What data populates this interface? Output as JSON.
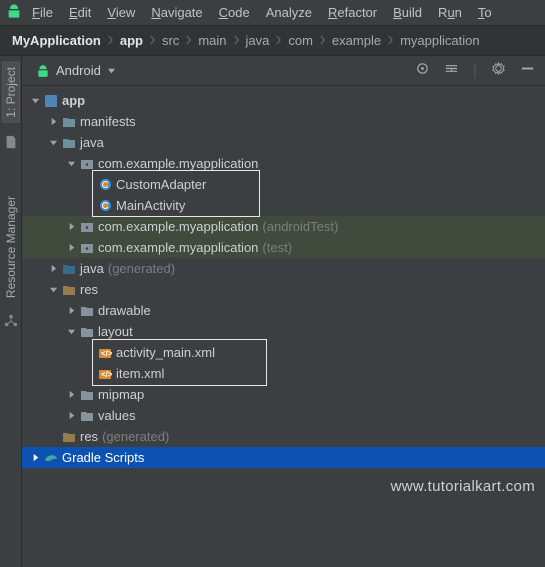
{
  "menu": {
    "file": "File",
    "edit": "Edit",
    "view": "View",
    "navigate": "Navigate",
    "code": "Code",
    "analyze": "Analyze",
    "refactor": "Refactor",
    "build": "Build",
    "run": "Run",
    "tools": "To"
  },
  "breadcrumbs": [
    "MyApplication",
    "app",
    "src",
    "main",
    "java",
    "com",
    "example",
    "myapplication"
  ],
  "panel": {
    "selector": "Android"
  },
  "sidetabs": {
    "project": "1: Project",
    "resmgr": "Resource Manager"
  },
  "tree": {
    "app": "app",
    "manifests": "manifests",
    "java": "java",
    "pkg_main": "com.example.myapplication",
    "customadapter": "CustomAdapter",
    "mainactivity": "MainActivity",
    "pkg_android_test": "com.example.myapplication",
    "pkg_android_test_note": "(androidTest)",
    "pkg_test": "com.example.myapplication",
    "pkg_test_note": "(test)",
    "java_gen": "java",
    "gen_note": "(generated)",
    "res": "res",
    "drawable": "drawable",
    "layout": "layout",
    "activity_main": "activity_main.xml",
    "item_xml": "item.xml",
    "mipmap": "mipmap",
    "values": "values",
    "res_gen": "res",
    "gradle": "Gradle Scripts"
  },
  "watermark": "www.tutorialkart.com"
}
